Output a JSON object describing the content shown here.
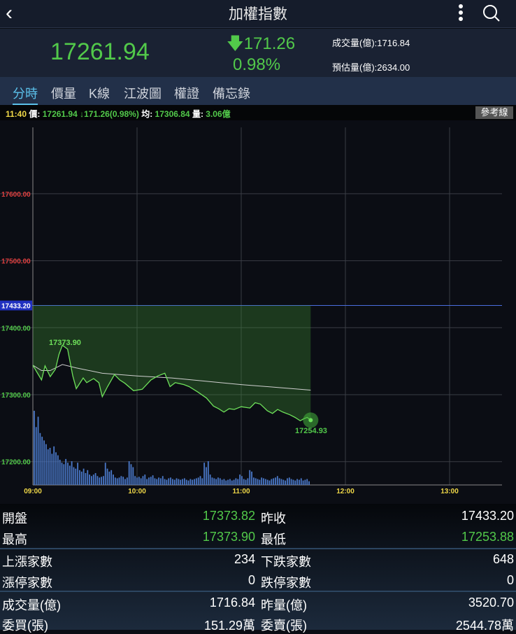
{
  "header": {
    "title": "加權指數",
    "back_icon": "chevron-left-icon",
    "more_icon": "more-vertical-icon",
    "search_icon": "search-icon"
  },
  "quote": {
    "price": "17261.94",
    "change": "171.26",
    "change_pct": "0.98%",
    "volume": "成交量(億):1716.84",
    "est_volume": "預估量(億):2634.00",
    "up_color": "#52c94a"
  },
  "tabs": [
    "分時",
    "價量",
    "K線",
    "江波圖",
    "權證",
    "備忘錄"
  ],
  "info": {
    "time": "11:40",
    "price_label": "價:",
    "price": "17261.94",
    "change": "↓171.26(0.98%)",
    "avg_label": "均:",
    "avg": "17306.84",
    "vol_label": "量:",
    "vol": "3.06億",
    "ref_button": "參考線"
  },
  "chart_data": {
    "type": "line",
    "x_ticks": [
      "09:00",
      "10:00",
      "11:00",
      "12:00",
      "13:00"
    ],
    "y_ticks": [
      "17600.00",
      "17500.00",
      "17400.00",
      "17300.00",
      "17200.00"
    ],
    "y_range": [
      17150,
      17700
    ],
    "x_range_minutes": [
      0,
      270
    ],
    "reference": {
      "label": "17433.20",
      "value": 17433.2
    },
    "high_label": "17373.90",
    "last_label": "17254.93",
    "price": {
      "minutes": [
        0,
        2,
        5,
        7,
        10,
        13,
        15,
        17,
        20,
        23,
        25,
        29,
        31,
        35,
        38,
        40,
        43,
        47,
        50,
        53,
        58,
        63,
        68,
        72,
        76,
        79,
        82,
        87,
        90,
        95,
        100,
        104,
        107,
        110,
        113,
        116,
        120,
        125,
        128,
        131,
        135,
        138,
        141,
        144,
        148,
        151,
        154,
        156,
        158,
        160
      ],
      "values": [
        17344,
        17335,
        17322,
        17343,
        17327,
        17338,
        17360,
        17373.9,
        17368,
        17328,
        17309,
        17325,
        17318,
        17324,
        17318,
        17297,
        17312,
        17330,
        17322,
        17317,
        17306,
        17308,
        17322,
        17328,
        17332,
        17312,
        17318,
        17315,
        17312,
        17304,
        17295,
        17283,
        17279,
        17274,
        17279,
        17278,
        17282,
        17280,
        17288,
        17286,
        17276,
        17272,
        17278,
        17274,
        17270,
        17266,
        17261,
        17264,
        17266,
        17261.94
      ]
    },
    "average": {
      "minutes": [
        0,
        5,
        10,
        17,
        25,
        40,
        60,
        80,
        100,
        120,
        140,
        160
      ],
      "values": [
        17344,
        17336,
        17336,
        17345,
        17340,
        17332,
        17328,
        17325,
        17320,
        17315,
        17311,
        17306.84
      ]
    },
    "volume": [
      100,
      78,
      92,
      70,
      65,
      60,
      55,
      48,
      50,
      42,
      52,
      44,
      40,
      34,
      30,
      28,
      35,
      30,
      26,
      32,
      24,
      22,
      30,
      20,
      18,
      22,
      16,
      20,
      14,
      12,
      14,
      16,
      12,
      10,
      11,
      12,
      30,
      22,
      18,
      20,
      14,
      10,
      9,
      10,
      12,
      11,
      8,
      10,
      32,
      28,
      24,
      12,
      10,
      11,
      9,
      12,
      14,
      8,
      10,
      11,
      13,
      9,
      8,
      10,
      9,
      12,
      8,
      7,
      9,
      10,
      8,
      7,
      9,
      8,
      7,
      8,
      9,
      7,
      6,
      8,
      7,
      8,
      9,
      10,
      12,
      9,
      30,
      24,
      32,
      14,
      10,
      9,
      8,
      10,
      9,
      7,
      8,
      6,
      7,
      8,
      6,
      7,
      9,
      8,
      14,
      12,
      8,
      7,
      9,
      20,
      18,
      10,
      9,
      8,
      7,
      10,
      9,
      8,
      7,
      6,
      8,
      9,
      10,
      12,
      9,
      8,
      7,
      6,
      9,
      10,
      8,
      7,
      6,
      8,
      7,
      9,
      6,
      7,
      8,
      5
    ]
  },
  "stats": [
    {
      "l1": "開盤",
      "v1": "17373.82",
      "l2": "昨收",
      "v2": "17433.20",
      "g1": true,
      "g2": false
    },
    {
      "l1": "最高",
      "v1": "17373.90",
      "l2": "最低",
      "v2": "17253.88",
      "g1": true,
      "g2": true
    },
    {
      "l1": "上漲家數",
      "v1": "234",
      "l2": "下跌家數",
      "v2": "648"
    },
    {
      "l1": "漲停家數",
      "v1": "0",
      "l2": "跌停家數",
      "v2": "0"
    },
    {
      "l1": "成交量(億)",
      "v1": "1716.84",
      "l2": "昨量(億)",
      "v2": "3520.70"
    },
    {
      "l1": "委買(張)",
      "v1": "151.29萬",
      "l2": "委賣(張)",
      "v2": "2544.78萬"
    }
  ]
}
